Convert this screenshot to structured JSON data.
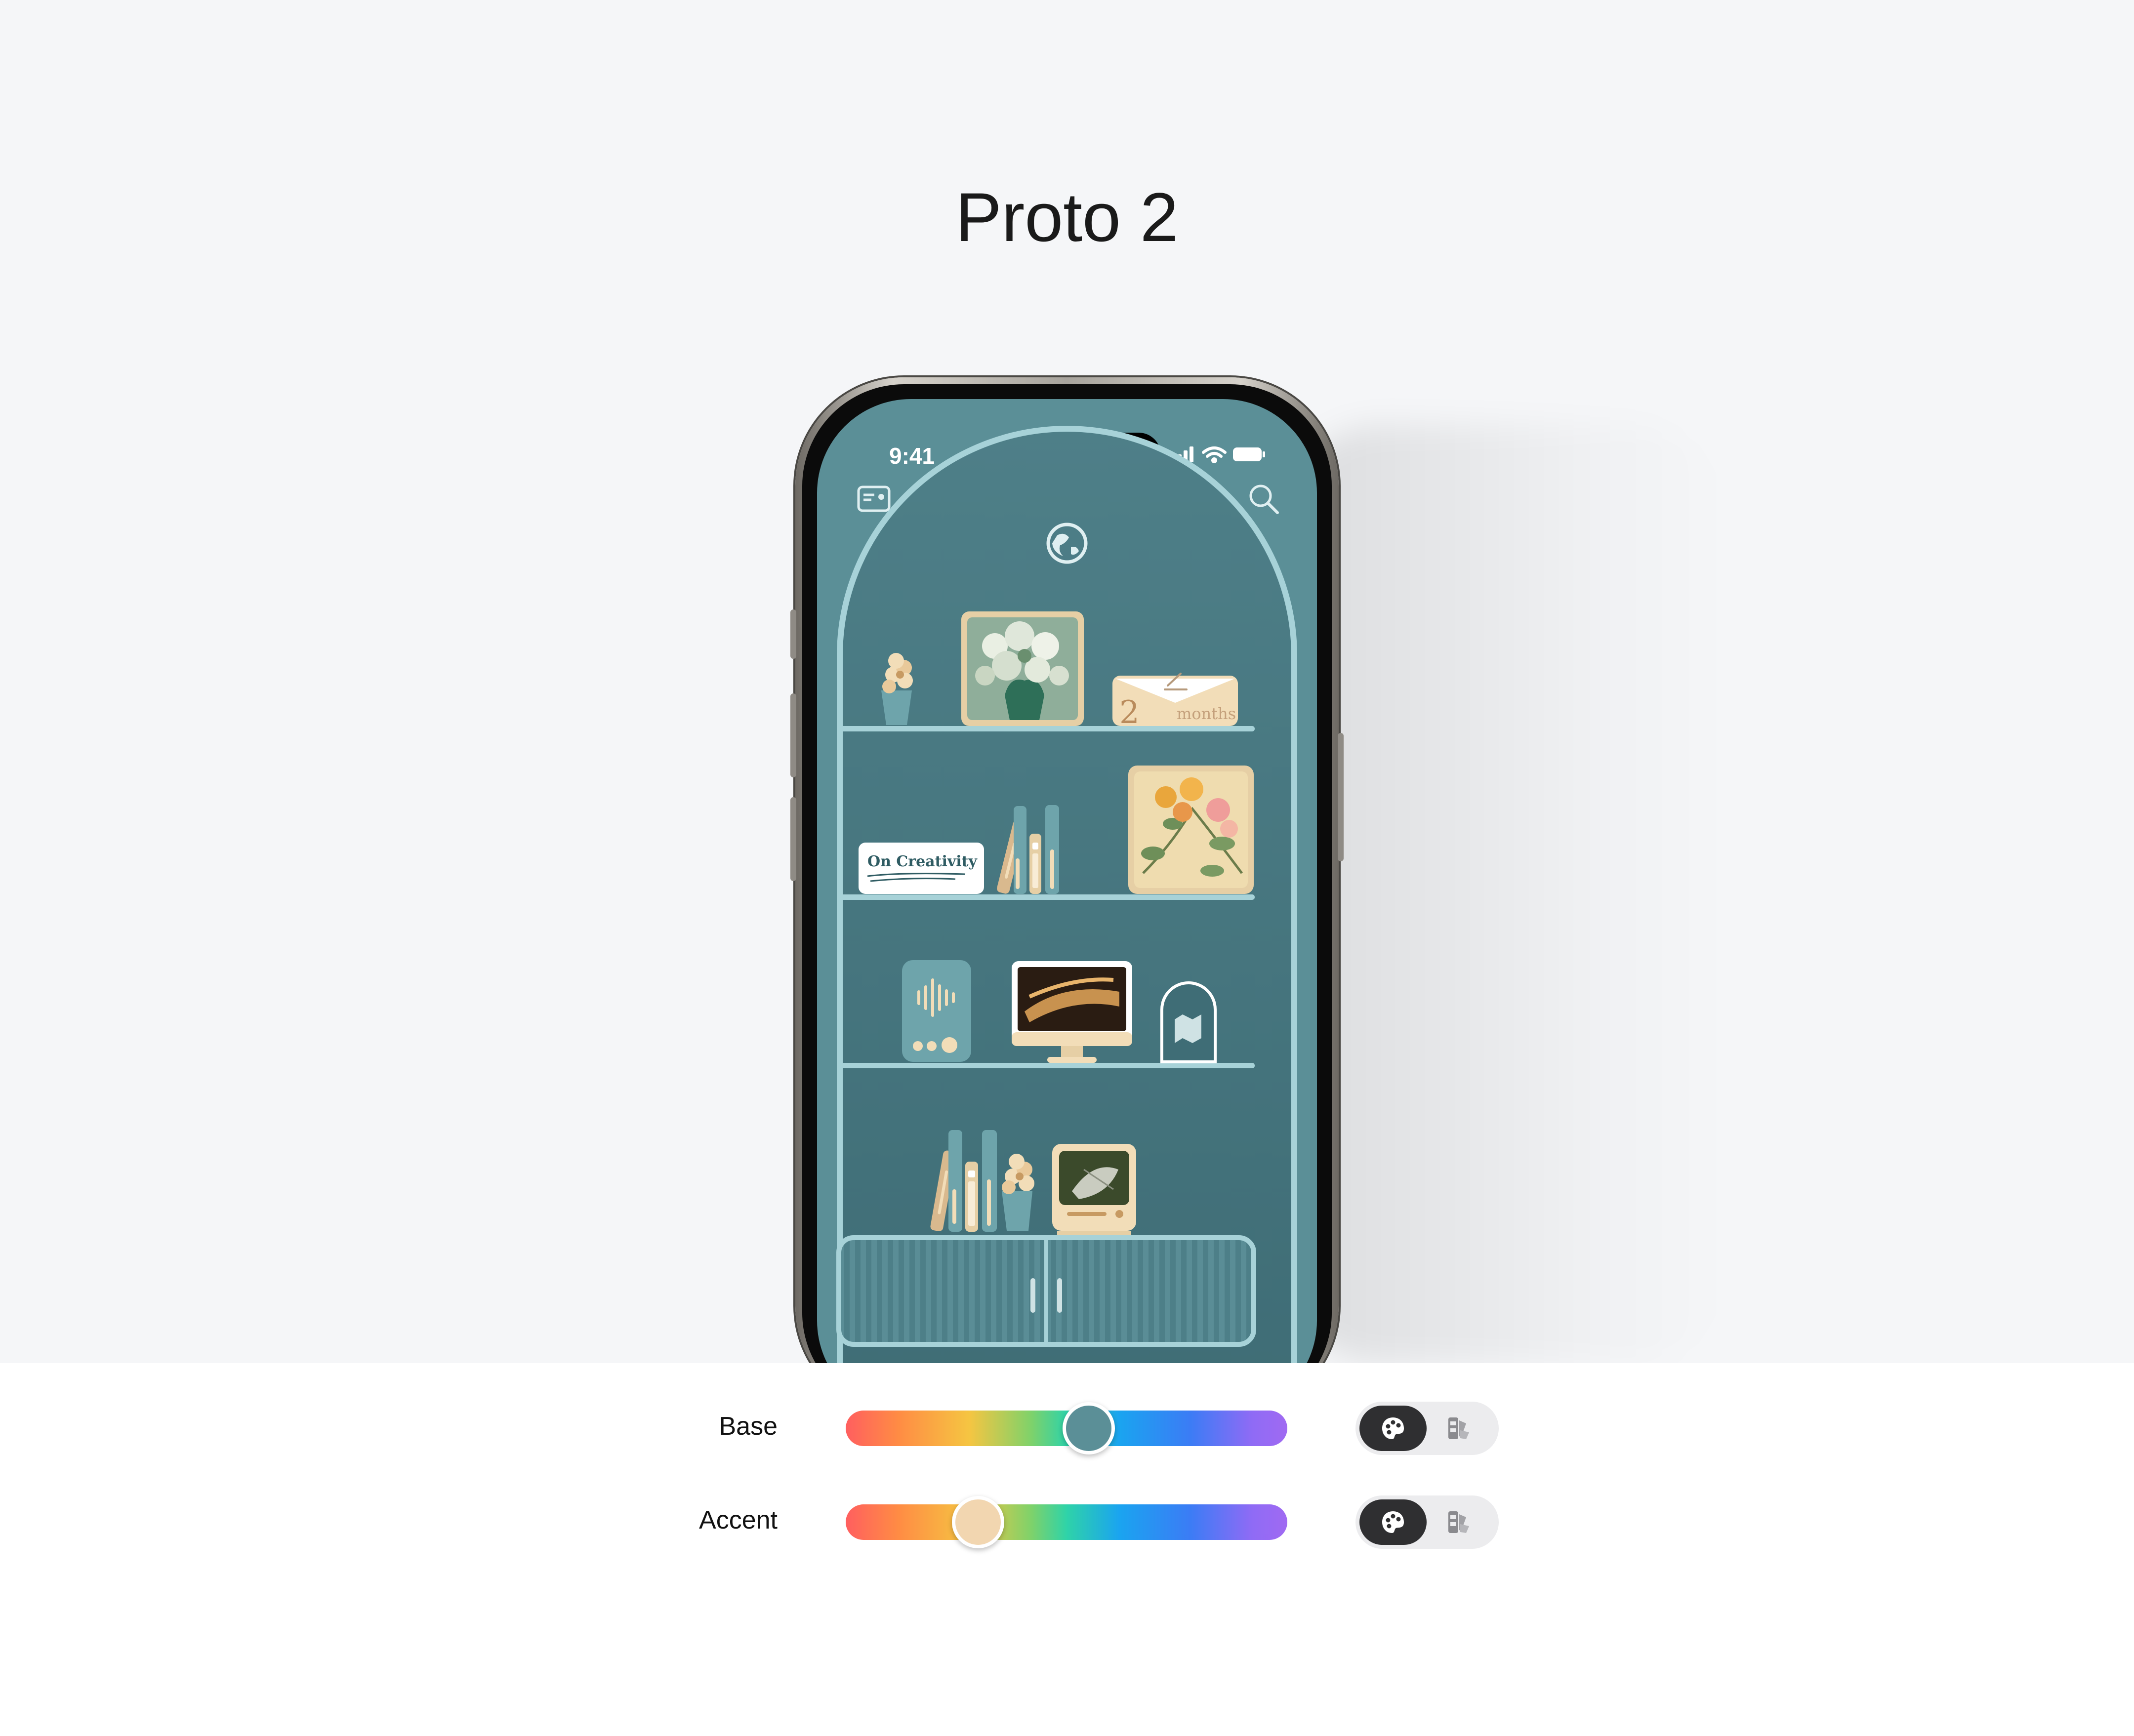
{
  "page": {
    "title": "Proto 2"
  },
  "phone": {
    "status_time": "9:41",
    "book_label": "On Creativity",
    "card_number": "2",
    "card_unit": "months"
  },
  "controls": {
    "base": {
      "label": "Base",
      "value": 0.55,
      "thumb_color": "#5b8f97"
    },
    "accent": {
      "label": "Accent",
      "value": 0.3,
      "thumb_color": "#f2d6b0"
    }
  },
  "colors": {
    "screen": "#5b8f97",
    "shelf": "#a7d2d8",
    "cream": "#f2ddb8",
    "tan": "#d9b98e"
  }
}
